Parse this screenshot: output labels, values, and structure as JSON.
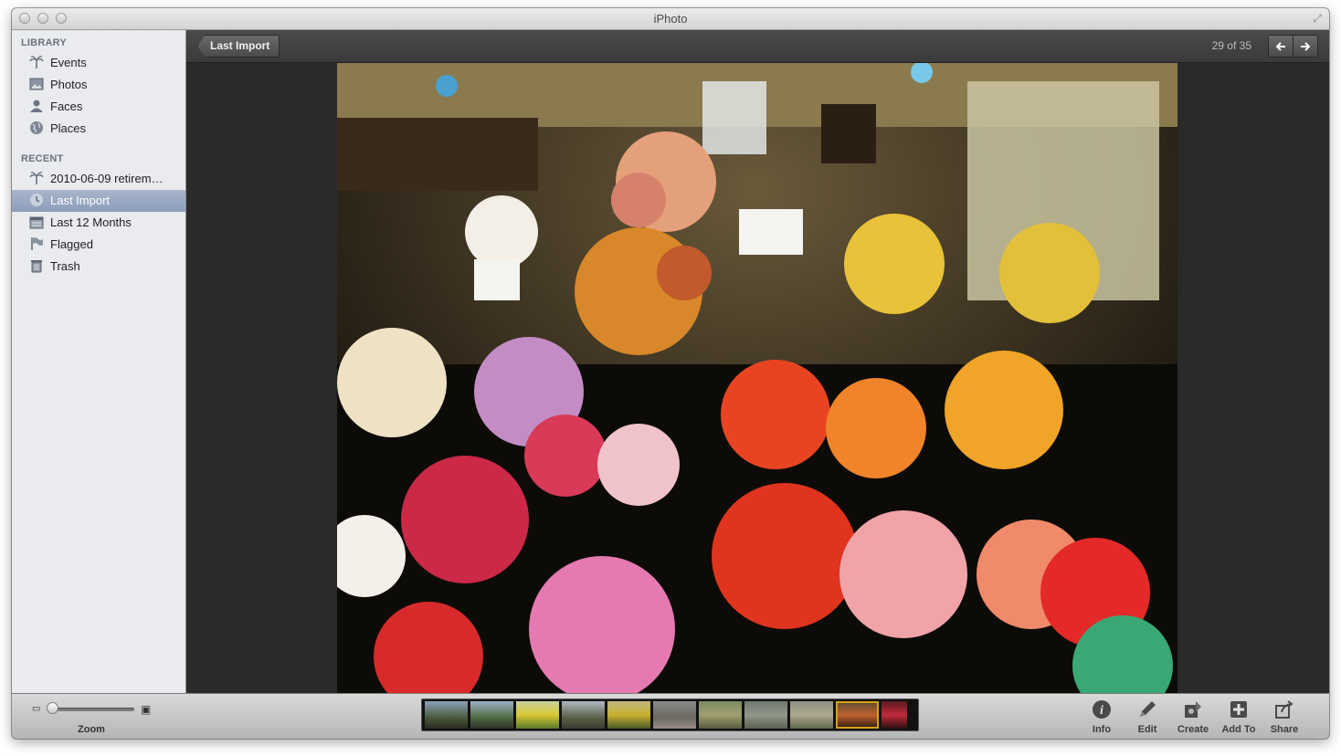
{
  "window": {
    "title": "iPhoto"
  },
  "sidebar": {
    "library_header": "LIBRARY",
    "library_items": [
      {
        "label": "Events",
        "icon": "palm-tree-icon"
      },
      {
        "label": "Photos",
        "icon": "photo-icon"
      },
      {
        "label": "Faces",
        "icon": "person-icon"
      },
      {
        "label": "Places",
        "icon": "globe-icon"
      }
    ],
    "recent_header": "RECENT",
    "recent_items": [
      {
        "label": "2010-06-09 retirem…",
        "icon": "palm-tree-icon"
      },
      {
        "label": "Last Import",
        "icon": "clock-icon",
        "selected": true
      },
      {
        "label": "Last 12 Months",
        "icon": "calendar-icon"
      },
      {
        "label": "Flagged",
        "icon": "flag-icon"
      },
      {
        "label": "Trash",
        "icon": "trash-icon"
      }
    ]
  },
  "topbar": {
    "back_label": "Last Import",
    "counter": "29 of 35",
    "prev_glyph": "🡐",
    "next_glyph": "🡒"
  },
  "viewer": {
    "photo_subject": "flower-market-photo"
  },
  "bottombar": {
    "zoom_label": "Zoom",
    "zoom_level": 0.0,
    "filmstrip_count": 11,
    "filmstrip_current_index": 9,
    "tools": [
      {
        "label": "Info",
        "icon": "info-icon"
      },
      {
        "label": "Edit",
        "icon": "pencil-icon"
      },
      {
        "label": "Create",
        "icon": "create-icon"
      },
      {
        "label": "Add To",
        "icon": "plus-icon"
      },
      {
        "label": "Share",
        "icon": "share-icon"
      }
    ]
  },
  "colors": {
    "selection": "#8d9dba",
    "viewer_bg": "#2a2a2a",
    "filmstrip_highlight": "#d4a21a"
  }
}
